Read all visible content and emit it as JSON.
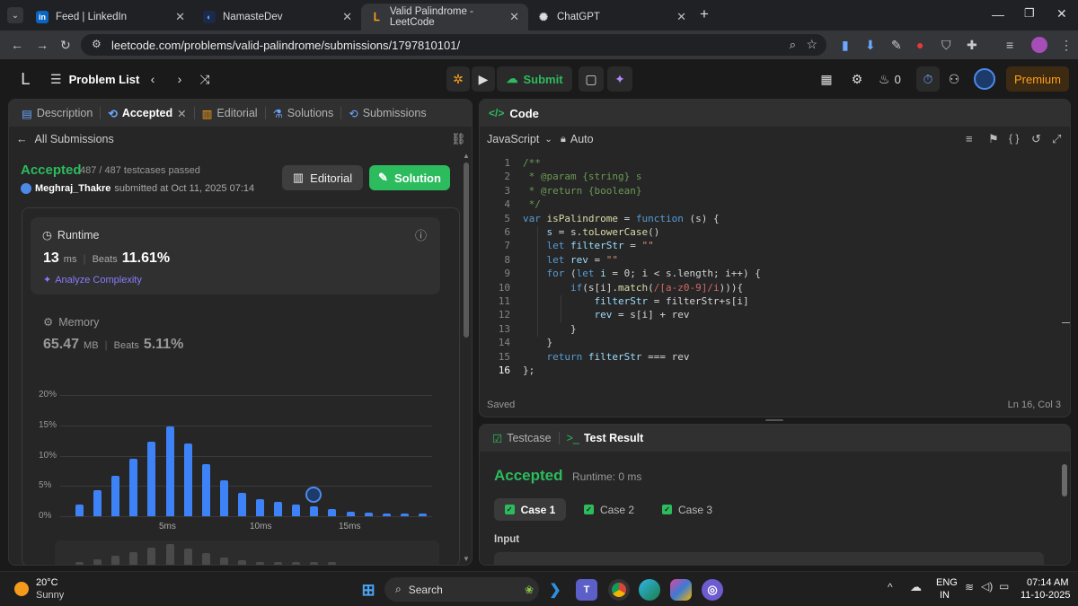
{
  "browser": {
    "tabs": [
      {
        "title": "Feed | LinkedIn",
        "icon": "linkedin-icon"
      },
      {
        "title": "NamasteDev",
        "icon": "namastedev-icon"
      },
      {
        "title": "Valid Palindrome - LeetCode",
        "icon": "leetcode-icon"
      },
      {
        "title": "ChatGPT",
        "icon": "chatgpt-icon"
      }
    ],
    "new_tab_label": "+",
    "url": "leetcode.com/problems/valid-palindrome/submissions/1797810101/"
  },
  "nav": {
    "problem_list": "Problem List",
    "submit": "Submit",
    "fire_count": "0",
    "premium": "Premium"
  },
  "left_panel": {
    "tabs": [
      "Description",
      "Accepted",
      "Editorial",
      "Solutions",
      "Submissions"
    ],
    "all_submissions": "All Submissions",
    "status": "Accepted",
    "testcases": "487 / 487 testcases passed",
    "user": "Meghraj_Thakre",
    "submitted_text": "submitted at Oct 11, 2025 07:14",
    "editorial_btn": "Editorial",
    "solution_btn": "Solution",
    "runtime": {
      "label": "Runtime",
      "value": "13",
      "unit": "ms",
      "beats_label": "Beats",
      "beats": "11.61%",
      "analyze": "Analyze Complexity"
    },
    "memory": {
      "label": "Memory",
      "value": "65.47",
      "unit": "MB",
      "beats_label": "Beats",
      "beats": "5.11%"
    }
  },
  "chart_data": {
    "type": "bar",
    "ytick_labels": [
      "20%",
      "15%",
      "10%",
      "5%",
      "0%"
    ],
    "xtick_labels": [
      "5ms",
      "10ms",
      "15ms"
    ],
    "ylim": [
      0,
      20
    ],
    "values": [
      2.0,
      4.3,
      6.7,
      9.5,
      12.3,
      14.8,
      12.0,
      8.6,
      5.9,
      3.9,
      2.8,
      2.3,
      1.9,
      1.7,
      1.2,
      0.8,
      0.6,
      0.5,
      0.5,
      0.4
    ],
    "highlight_index": 13
  },
  "code_panel": {
    "title": "Code",
    "language": "JavaScript",
    "mode": "Auto",
    "saved": "Saved",
    "cursor": "Ln 16, Col 3",
    "lines": [
      [
        [
          "cm",
          "/**"
        ]
      ],
      [
        [
          "cm",
          " * @param {string} s"
        ]
      ],
      [
        [
          "cm",
          " * @return {boolean}"
        ]
      ],
      [
        [
          "cm",
          " */"
        ]
      ],
      [
        [
          "kw",
          "var "
        ],
        [
          "fn",
          "isPalindrome"
        ],
        [
          "pl",
          " = "
        ],
        [
          "kw",
          "function"
        ],
        [
          "pl",
          " (s) {"
        ]
      ],
      [
        [
          "vr",
          "    s"
        ],
        [
          "pl",
          " = s."
        ],
        [
          "fn",
          "toLowerCase"
        ],
        [
          "pl",
          "()"
        ]
      ],
      [
        [
          "kw",
          "    let "
        ],
        [
          "vr",
          "filterStr"
        ],
        [
          "pl",
          " = "
        ],
        [
          "st",
          "\"\""
        ]
      ],
      [
        [
          "kw",
          "    let "
        ],
        [
          "vr",
          "rev"
        ],
        [
          "pl",
          " = "
        ],
        [
          "st",
          "\"\""
        ]
      ],
      [
        [
          "kw",
          "    for"
        ],
        [
          "pl",
          " ("
        ],
        [
          "kw",
          "let "
        ],
        [
          "vr",
          "i"
        ],
        [
          "pl",
          " = 0; i < s.length; i++) {"
        ]
      ],
      [
        [
          "kw",
          "        if"
        ],
        [
          "pl",
          "(s[i]."
        ],
        [
          "fn",
          "match"
        ],
        [
          "pl",
          "("
        ],
        [
          "rx",
          "/[a-z0-9]/i"
        ],
        [
          "pl",
          "))){"
        ]
      ],
      [
        [
          "vr",
          "            filterStr"
        ],
        [
          "pl",
          " = filterStr+s[i]"
        ]
      ],
      [
        [
          "vr",
          "            rev"
        ],
        [
          "pl",
          " = s[i] + rev"
        ]
      ],
      [
        [
          "pl",
          "        }"
        ]
      ],
      [
        [
          "pl",
          "    }"
        ]
      ],
      [
        [
          "kw",
          "    return "
        ],
        [
          "vr",
          "filterStr"
        ],
        [
          "pl",
          " === rev"
        ]
      ],
      [
        [
          "pl",
          "};"
        ]
      ]
    ]
  },
  "result_panel": {
    "tab1": "Testcase",
    "tab2": "Test Result",
    "status": "Accepted",
    "runtime": "Runtime: 0 ms",
    "cases": [
      "Case 1",
      "Case 2",
      "Case 3"
    ],
    "input_label": "Input"
  },
  "taskbar": {
    "temp": "20°C",
    "weather": "Sunny",
    "search": "Search",
    "lang1": "ENG",
    "lang2": "IN",
    "time": "07:14 AM",
    "date": "11-10-2025"
  }
}
